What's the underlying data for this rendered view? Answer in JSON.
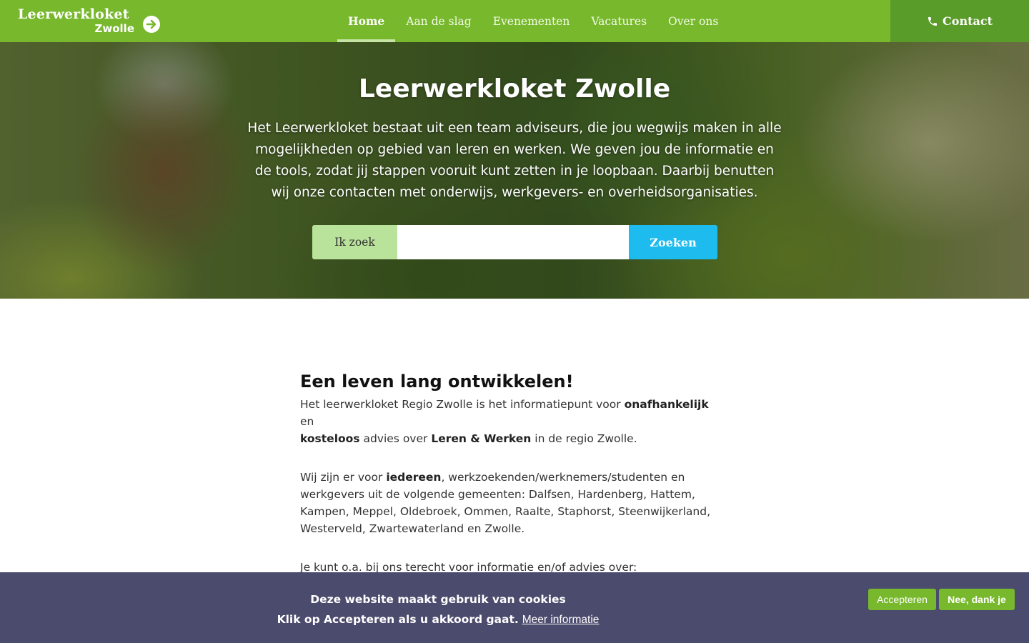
{
  "header": {
    "logo_name": "Leerwerkloket",
    "logo_city": "Zwolle",
    "logo_icon": "arrow-right-circle-icon",
    "nav": [
      {
        "label": "Home",
        "active": true
      },
      {
        "label": "Aan de slag",
        "active": false
      },
      {
        "label": "Evenementen",
        "active": false
      },
      {
        "label": "Vacatures",
        "active": false
      },
      {
        "label": "Over ons",
        "active": false
      }
    ],
    "contact_label": "Contact",
    "contact_icon": "phone-icon"
  },
  "hero": {
    "title": "Leerwerkloket Zwolle",
    "text": "Het Leerwerkloket bestaat uit een team adviseurs, die jou wegwijs maken in alle mogelijkheden op gebied van leren en werken. We geven jou de informatie en de tools, zodat jij stappen vooruit kunt zetten in je loopbaan. Daarbij benutten wij onze contacten met onderwijs, werkgevers- en overheidsorganisaties.",
    "search_label": "Ik zoek",
    "search_value": "",
    "search_button": "Zoeken"
  },
  "content": {
    "heading": "Een leven lang ontwikkelen!",
    "p1": {
      "t1": "Het leerwerkloket Regio Zwolle is het informatiepunt voor ",
      "b1": "onafhankelijk",
      "t2": " en ",
      "b2": "kosteloos",
      "t3": " advies over ",
      "b3": "Leren & Werken",
      "t4": " in de regio Zwolle."
    },
    "p2": {
      "t1": "Wij zijn er voor ",
      "b1": "iedereen",
      "t2": ", werkzoekenden/werknemers/studenten en werkgevers uit de volgende gemeenten: Dalfsen, Hardenberg, Hattem, Kampen, Meppel, Oldebroek, Ommen, Raalte, Staphorst, Steenwijkerland, Westerveld, Zwartewaterland en Zwolle."
    },
    "p3": "Je kunt o.a. bij ons terecht voor informatie en/of advies over:"
  },
  "cookie": {
    "title": "Deze website maakt gebruik van cookies",
    "line2": "Klik op Accepteren als u akkoord gaat.",
    "link": "Meer informatie",
    "accept": "Accepteren",
    "decline": "Nee, dank je"
  },
  "colors": {
    "header_green": "#77b82c",
    "contact_green": "#5a9c2a",
    "search_label_bg": "#b9e39a",
    "search_button_blue": "#1ebcee",
    "cookie_bg": "#4b4b6d"
  }
}
